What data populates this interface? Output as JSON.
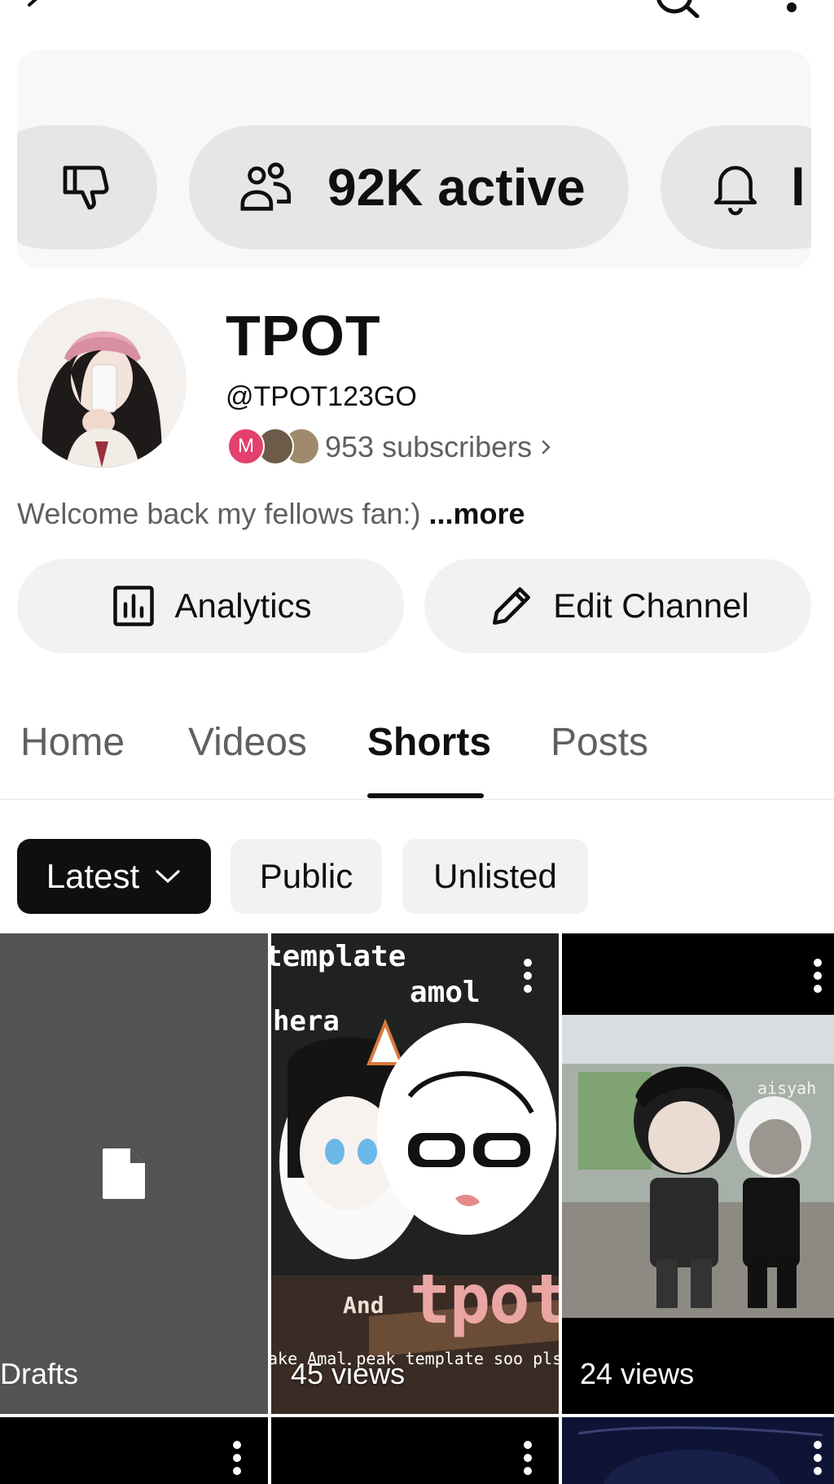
{
  "stats": {
    "active_label": "92K active"
  },
  "channel": {
    "name": "TPOT",
    "handle": "@TPOT123GO",
    "subscriber_initial": "M",
    "subscribers": "953 subscribers",
    "description": "Welcome back my fellows fan:)",
    "more_label": "...more"
  },
  "actions": {
    "analytics_label": "Analytics",
    "edit_label": "Edit Channel"
  },
  "tabs": [
    {
      "label": "Home"
    },
    {
      "label": "Videos"
    },
    {
      "label": "Shorts",
      "active": true
    },
    {
      "label": "Posts"
    }
  ],
  "filters": {
    "latest_label": "Latest",
    "public_label": "Public",
    "unlisted_label": "Unlisted"
  },
  "grid": {
    "drafts_label": "Drafts",
    "items": [
      {
        "views": "45 views",
        "overlay_text": [
          "template",
          "amol",
          "hera",
          "And",
          "tpot",
          "ake Amal peak template soo pls en"
        ]
      },
      {
        "views": "24 views",
        "overlay_text": [
          "aisyah"
        ]
      }
    ]
  },
  "colors": {
    "accent_dark": "#0f0f0f",
    "secondary_text": "#606060",
    "chip_background": "#f2f2f2",
    "subscriber_badge": "#e2416e"
  }
}
